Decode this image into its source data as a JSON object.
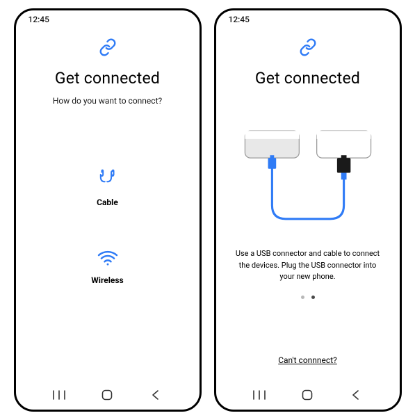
{
  "colors": {
    "accent": "#2f7bf6",
    "text": "#000000"
  },
  "phone1": {
    "status_time": "12:45",
    "title": "Get connected",
    "subtitle": "How do you want to connect?",
    "options": {
      "cable_label": "Cable",
      "wireless_label": "Wireless"
    }
  },
  "phone2": {
    "status_time": "12:45",
    "title": "Get connected",
    "instruction": "Use a USB connector and cable to connect the devices. Plug the USB connector into your new phone.",
    "page_index": 1,
    "page_count": 2,
    "help_link": "Can't connnect?"
  }
}
